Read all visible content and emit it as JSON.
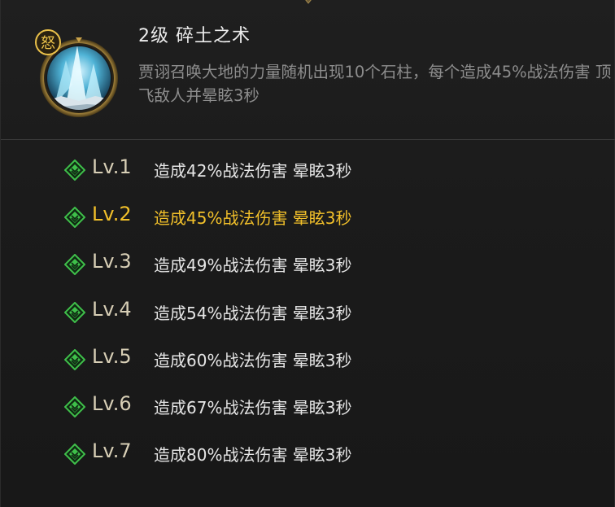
{
  "skill": {
    "icon_name": "ice-crystal-skill-icon",
    "badge_glyph": "怒",
    "title": "2级 碎土之术",
    "description": "贾诩召唤大地的力量随机出现10个石柱，每个造成45%战法伤害 顶飞敌人并晕眩3秒"
  },
  "levels": [
    {
      "label": "Lv.1",
      "effect": "造成42%战法伤害 晕眩3秒",
      "current": false
    },
    {
      "label": "Lv.2",
      "effect": "造成45%战法伤害 晕眩3秒",
      "current": true
    },
    {
      "label": "Lv.3",
      "effect": "造成49%战法伤害 晕眩3秒",
      "current": false
    },
    {
      "label": "Lv.4",
      "effect": "造成54%战法伤害 晕眩3秒",
      "current": false
    },
    {
      "label": "Lv.5",
      "effect": "造成60%战法伤害 晕眩3秒",
      "current": false
    },
    {
      "label": "Lv.6",
      "effect": "造成67%战法伤害 晕眩3秒",
      "current": false
    },
    {
      "label": "Lv.7",
      "effect": "造成80%战法伤害 晕眩3秒",
      "current": false
    }
  ],
  "colors": {
    "current_level": "#f2c02a",
    "level_icon_green": "#3fbf4a",
    "badge_gold": "#e9c04a"
  }
}
